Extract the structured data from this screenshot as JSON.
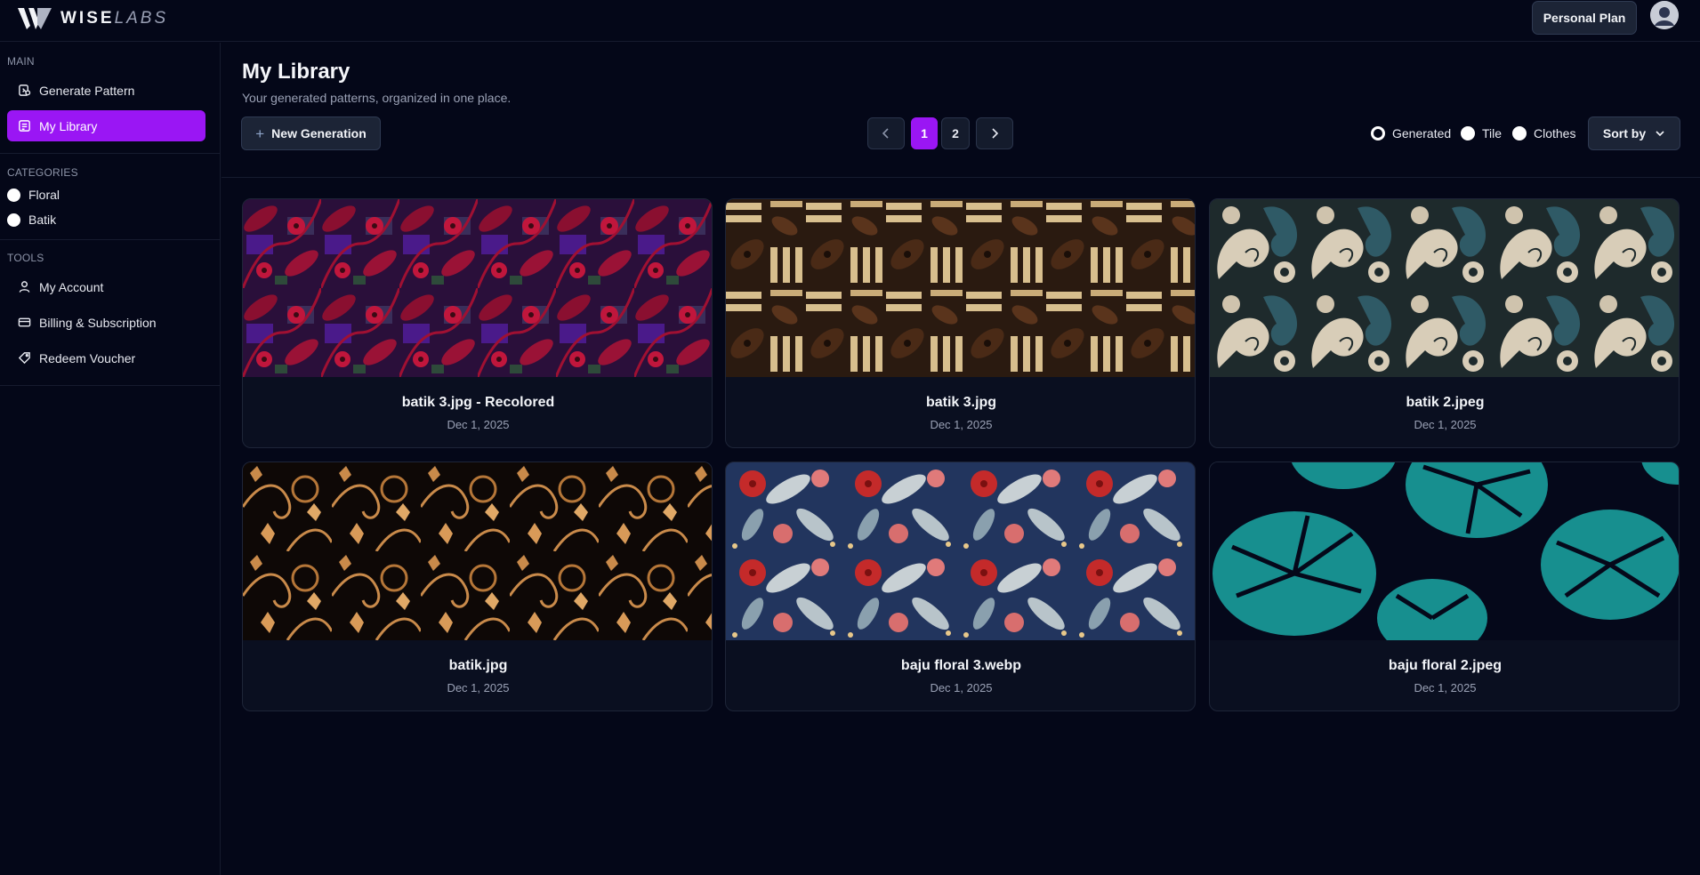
{
  "app": {
    "brand_bold": "WISE",
    "brand_light": "LABS",
    "plan_label": "Personal Plan"
  },
  "sidebar": {
    "main_label": "MAIN",
    "main_items": [
      {
        "label": "Generate Pattern",
        "icon": "pattern-icon"
      },
      {
        "label": "My Library",
        "icon": "library-icon",
        "active": true
      }
    ],
    "categories_label": "CATEGORIES",
    "categories": [
      {
        "label": "Floral"
      },
      {
        "label": "Batik"
      }
    ],
    "tools_label": "TOOLS",
    "tools_items": [
      {
        "label": "My Account",
        "icon": "user-icon"
      },
      {
        "label": "Billing & Subscription",
        "icon": "credit-card-icon"
      },
      {
        "label": "Redeem Voucher",
        "icon": "tag-icon"
      }
    ]
  },
  "main": {
    "title": "My Library",
    "subtitle": "Your generated patterns, organized in one place.",
    "new_button_label": "New Generation",
    "pagination": {
      "pages": [
        "1",
        "2"
      ],
      "current": "1"
    },
    "filters": [
      {
        "label": "Generated",
        "selected": true
      },
      {
        "label": "Tile",
        "selected": false
      },
      {
        "label": "Clothes",
        "selected": false
      }
    ],
    "sort_label": "Sort by",
    "cards": [
      {
        "name": "batik 3.jpg - Recolored",
        "date": "Dec 1, 2025"
      },
      {
        "name": "batik 3.jpg",
        "date": "Dec 1, 2025"
      },
      {
        "name": "batik 2.jpeg",
        "date": "Dec 1, 2025"
      },
      {
        "name": "batik.jpg",
        "date": "Dec 1, 2025"
      },
      {
        "name": "baju floral 3.webp",
        "date": "Dec 1, 2025"
      },
      {
        "name": "baju floral 2.jpeg",
        "date": "Dec 1, 2025"
      }
    ]
  },
  "colors": {
    "accent": "#9a16f4",
    "background": "#040718",
    "button": "#1c2436"
  }
}
